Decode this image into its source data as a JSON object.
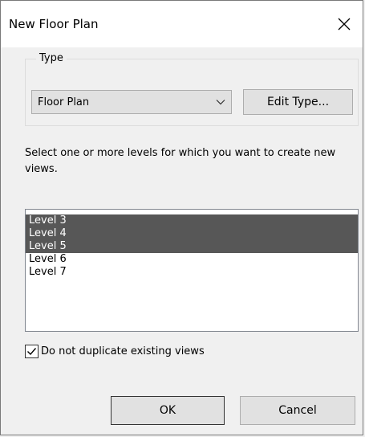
{
  "window": {
    "title": "New Floor Plan",
    "close_icon": "close-icon"
  },
  "type_group": {
    "label": "Type",
    "select": {
      "value": "Floor Plan",
      "icon": "chevron-down-icon"
    },
    "edit_type_label": "Edit Type..."
  },
  "instructions": "Select one or more levels for which you want to create new views.",
  "levels": {
    "items": [
      {
        "label": "Level 3",
        "selected": true
      },
      {
        "label": "Level 4",
        "selected": true
      },
      {
        "label": "Level 5",
        "selected": true
      },
      {
        "label": "Level 6",
        "selected": false
      },
      {
        "label": "Level 7",
        "selected": false
      }
    ]
  },
  "no_duplicates": {
    "label": "Do not duplicate existing views",
    "checked": true
  },
  "buttons": {
    "ok": "OK",
    "cancel": "Cancel"
  },
  "colors": {
    "selection": "#575757",
    "dialog_bg": "#f0f0f0",
    "button_bg": "#e1e1e1"
  }
}
